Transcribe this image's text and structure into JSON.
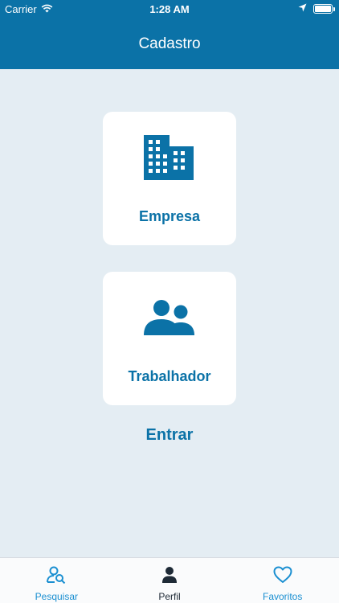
{
  "status_bar": {
    "carrier": "Carrier",
    "time": "1:28 AM",
    "wifi_icon": "wifi-icon",
    "location_icon": "location-arrow-icon",
    "battery_icon": "battery-full-icon"
  },
  "header": {
    "title": "Cadastro",
    "background_color": "#0b72a7"
  },
  "options": [
    {
      "label": "Empresa",
      "icon": "building-icon"
    },
    {
      "label": "Trabalhador",
      "icon": "users-icon"
    }
  ],
  "login_link": "Entrar",
  "tab_bar": {
    "items": [
      {
        "label": "Pesquisar",
        "icon": "user-search-icon",
        "active": false
      },
      {
        "label": "Perfil",
        "icon": "person-icon",
        "active": true
      },
      {
        "label": "Favoritos",
        "icon": "heart-icon",
        "active": false
      }
    ]
  },
  "colors": {
    "accent": "#0b72a7",
    "background": "#e4edf3",
    "tab_inactive": "#1a8fd1",
    "tab_active": "#1e2a36"
  }
}
